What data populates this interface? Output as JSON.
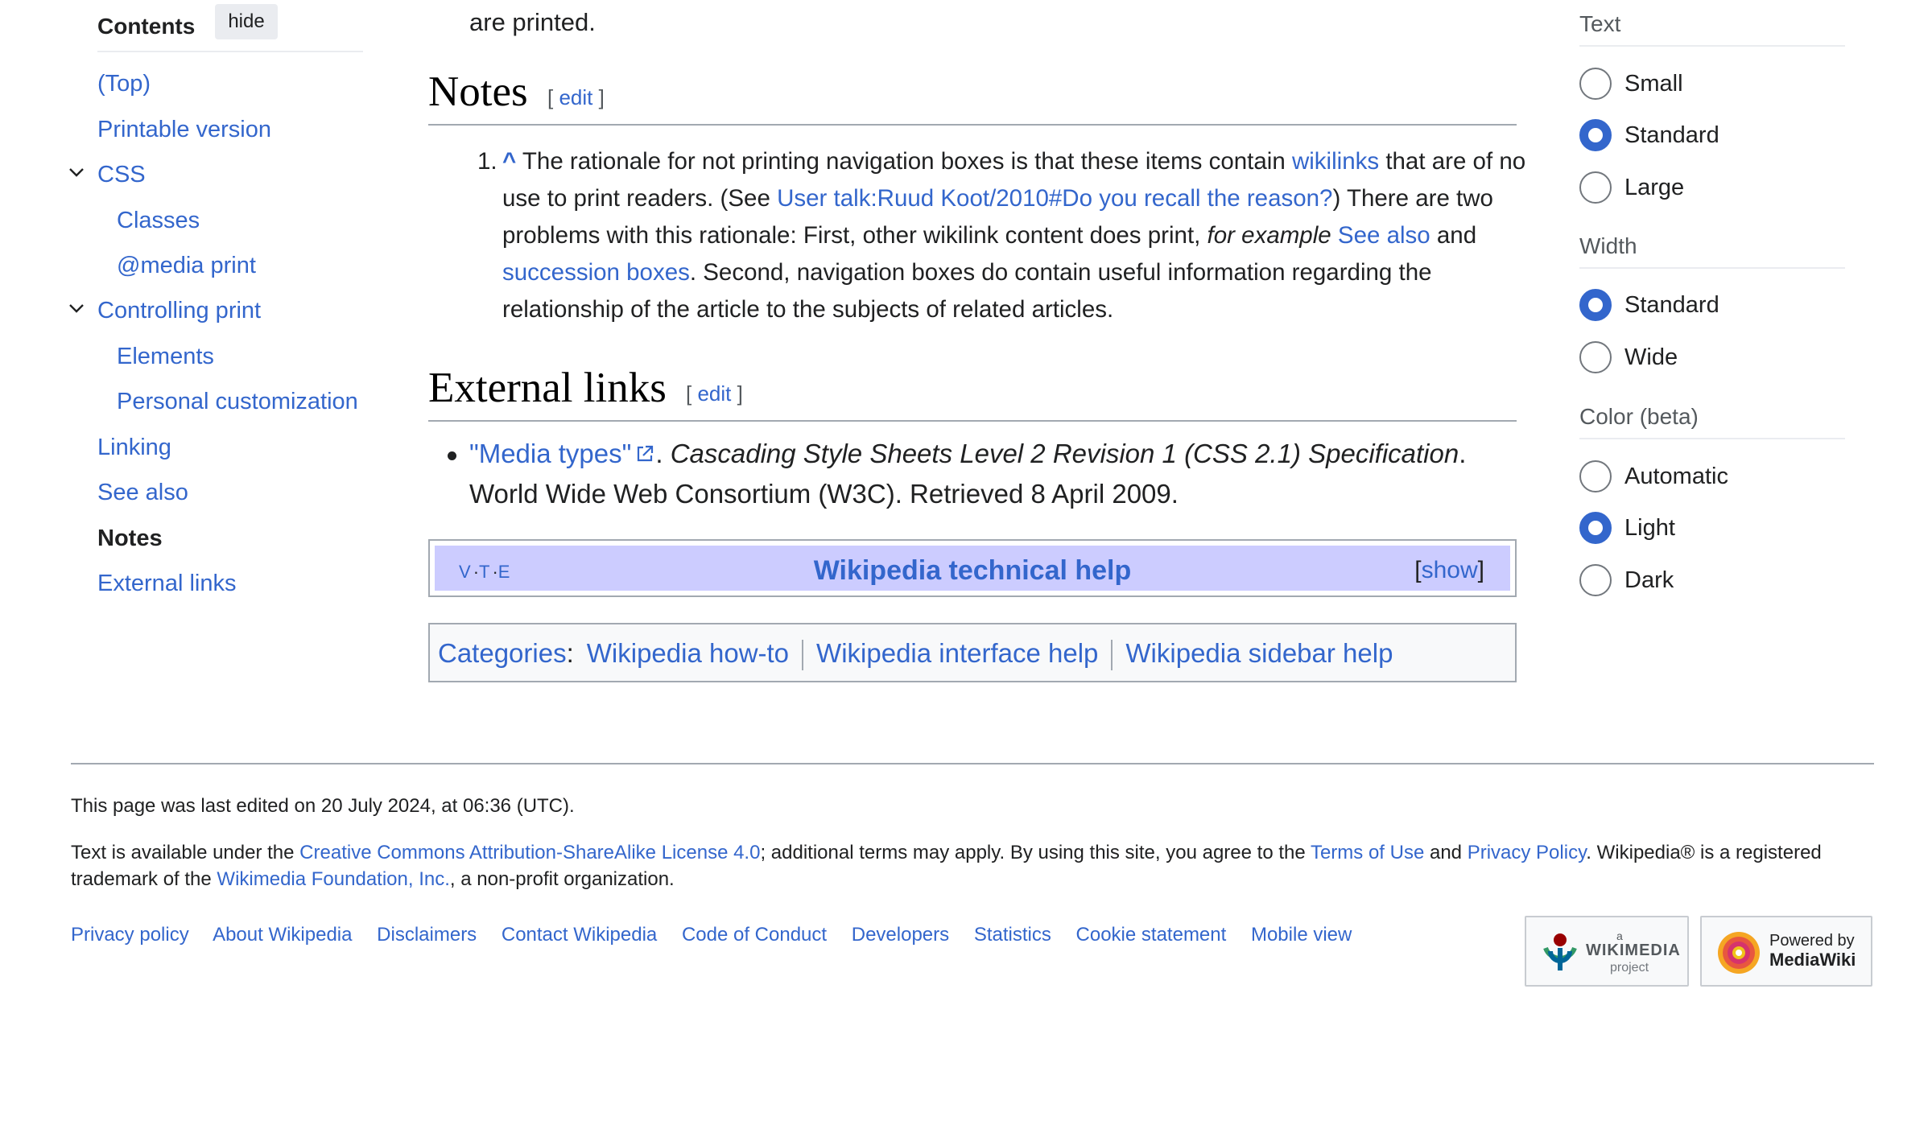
{
  "toc": {
    "title": "Contents",
    "hide_label": "hide",
    "items": [
      {
        "label": "(Top)"
      },
      {
        "label": "Printable version"
      },
      {
        "label": "CSS"
      },
      {
        "label": "Classes"
      },
      {
        "label": "@media print"
      },
      {
        "label": "Controlling print"
      },
      {
        "label": "Elements"
      },
      {
        "label": "Personal customization"
      },
      {
        "label": "Linking"
      },
      {
        "label": "See also"
      },
      {
        "label": "Notes"
      },
      {
        "label": "External links"
      }
    ]
  },
  "content": {
    "printed_tail": "are printed.",
    "notes": {
      "heading": "Notes",
      "edit_open": "[ ",
      "edit_label": "edit",
      "edit_close": " ]",
      "number": "1.",
      "caret": "^",
      "t1": " The rationale for not printing navigation boxes is that these items contain ",
      "link_wikilinks": "wikilinks",
      "t2": " that are of no",
      "t3": "use to print readers. (See ",
      "link_user_talk": "User talk:Ruud Koot/2010#Do you recall the reason?",
      "t4": ") There are two",
      "t5": "problems with this rationale: First, other wikilink content does print, ",
      "t5_italic": "for example",
      "t5_space": " ",
      "link_see_also": "See also",
      "t6": " and",
      "link_succession": "succession boxes",
      "t7": ". Second, navigation boxes do contain useful information regarding the",
      "t8": "relationship of the article to the subjects of related articles."
    },
    "external": {
      "heading": "External links",
      "edit_open": "[ ",
      "edit_label": "edit",
      "edit_close": " ]",
      "link_media_types": "\"Media types\"",
      "dot_space": ". ",
      "italic_title": "Cascading Style Sheets Level 2 Revision 1 (CSS 2.1) Specification",
      "period": ".",
      "line2": "World Wide Web Consortium (W3C). Retrieved 8 April 2009."
    },
    "navbox": {
      "v": "V",
      "t": "T",
      "e": "E",
      "dot": "·",
      "title": "Wikipedia technical help",
      "show_open": "[",
      "show_label": "show",
      "show_close": "]"
    },
    "categories": {
      "label": "Categories",
      "colon": ":",
      "items": [
        "Wikipedia how-to",
        "Wikipedia interface help",
        "Wikipedia sidebar help"
      ]
    }
  },
  "appearance": {
    "text_heading": "Text",
    "text_options": [
      "Small",
      "Standard",
      "Large"
    ],
    "text_selected": "Standard",
    "width_heading": "Width",
    "width_options": [
      "Standard",
      "Wide"
    ],
    "width_selected": "Standard",
    "color_heading": "Color (beta)",
    "color_options": [
      "Automatic",
      "Light",
      "Dark"
    ],
    "color_selected": "Light"
  },
  "footer": {
    "last_edited": "This page was last edited on 20 July 2024, at 06:36 (UTC).",
    "lic_t1": "Text is available under the ",
    "lic_link1": "Creative Commons Attribution-ShareAlike License 4.0",
    "lic_t2": "; additional terms may apply. By using this site, you agree to the ",
    "lic_link2": "Terms of Use",
    "lic_t3": " and ",
    "lic_link3": "Privacy Policy",
    "lic_t4": ". Wikipedia® is a registered",
    "lic_t5": "trademark of the ",
    "lic_link4": "Wikimedia Foundation, Inc.",
    "lic_t6": ", a non-profit organization.",
    "links": [
      "Privacy policy",
      "About Wikipedia",
      "Disclaimers",
      "Contact Wikipedia",
      "Code of Conduct",
      "Developers",
      "Statistics",
      "Cookie statement",
      "Mobile view"
    ],
    "wikimedia_badge": {
      "small": "a",
      "name": "WIKIMEDIA",
      "sub": "project"
    },
    "mediawiki_badge": {
      "line1": "Powered by",
      "line2": "MediaWiki"
    }
  },
  "colors": {
    "link": "#3366cc",
    "text": "#202122",
    "navbox_title_bg": "#ccccff",
    "radio_checked": "#3366cc"
  }
}
